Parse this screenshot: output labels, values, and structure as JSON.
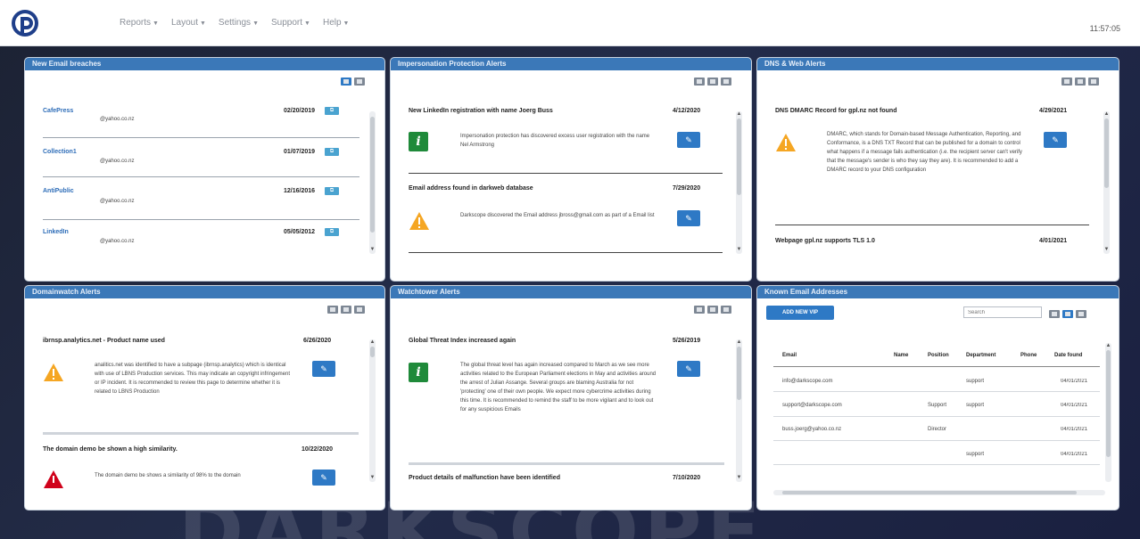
{
  "nav": {
    "items": [
      "Reports",
      "Layout",
      "Settings",
      "Support",
      "Help"
    ],
    "clock": "11:57:05"
  },
  "colors": {
    "header_blue": "#3b78b8",
    "button_blue": "#2e79c5",
    "info_green": "#1f8a3a",
    "warning_orange": "#f5a623",
    "danger_red": "#d0021b"
  },
  "panels": {
    "breaches": {
      "title": "New Email breaches",
      "rows": [
        {
          "source": "CafePress",
          "date": "02/20/2019",
          "email": "@yahoo.co.nz"
        },
        {
          "source": "Collection1",
          "date": "01/07/2019",
          "email": "@yahoo.co.nz"
        },
        {
          "source": "AntiPublic",
          "date": "12/16/2016",
          "email": "@yahoo.co.nz"
        },
        {
          "source": "LinkedIn",
          "date": "05/05/2012",
          "email": "@yahoo.co.nz"
        }
      ]
    },
    "impersonation": {
      "title": "Impersonation Protection Alerts",
      "alerts": [
        {
          "title": "New LinkedIn registration with name Joerg Buss",
          "date": "4/12/2020",
          "text": "Impersonation protection has discovered excess user registration with the name Nel Armstrong"
        },
        {
          "title": "Email address found in darkweb database",
          "date": "7/29/2020",
          "text": "Darkscope discovered the Email address jbross@gmail.com as part of a Email list"
        }
      ]
    },
    "dns": {
      "title": "DNS & Web Alerts",
      "alerts": [
        {
          "title": "DNS DMARC Record for gpl.nz not found",
          "date": "4/29/2021",
          "text": "DMARC, which stands for Domain-based Message Authentication, Reporting, and Conformance, is a DNS TXT Record that can be published for a domain to control what happens if a message fails authentication (i.e. the recipient server can't verify that the message's sender is who they say they are). It is recommended to add a DMARC record to your DNS configuration"
        },
        {
          "title": "Webpage gpl.nz supports TLS 1.0",
          "date": "4/01/2021"
        }
      ]
    },
    "domainwatch": {
      "title": "Domainwatch Alerts",
      "alerts": [
        {
          "title": "ibrnsp.analytics.net - Product name used",
          "date": "6/26/2020",
          "text": "analitics.net was identified to have a subpage (ibrnsp.analytics) which is identical with use of LBNS Production services. This may indicate an copyright infringement or IP incident. It is recommended to review this page to determine whether it is related to LBNS Production"
        },
        {
          "title": "The domain demo be shown a high similarity.",
          "date": "10/22/2020",
          "text": "The domain demo be shows a similarity of 98% to the domain"
        }
      ]
    },
    "watchtower": {
      "title": "Watchtower Alerts",
      "alerts": [
        {
          "title": "Global Threat Index increased again",
          "date": "5/26/2019",
          "text": "The global threat level has again increased compared to March as we see more activities related to the European Parliament elections in May and activities around the arrest of Julian Assange. Several groups are blaming Australia for not 'protecting' one of their own people. We expect more cybercrime activities during this time. It is recommended to remind the staff to be more vigilant and to look out for any suspicious Emails"
        },
        {
          "title": "Product details of malfunction have been identified",
          "date": "7/10/2020"
        }
      ]
    },
    "known_emails": {
      "title": "Known Email Addresses",
      "add_button": "ADD NEW VIP",
      "search_placeholder": "Search",
      "columns": [
        "Email",
        "Name",
        "Position",
        "Department",
        "Phone",
        "Date found"
      ],
      "rows": [
        {
          "email": "info@darkscope.com",
          "name": "",
          "position": "",
          "department": "support",
          "phone": "",
          "date": "04/01/2021"
        },
        {
          "email": "support@darkscope.com",
          "name": "",
          "position": "Support",
          "department": "support",
          "phone": "",
          "date": "04/01/2021"
        },
        {
          "email": "buss.joerg@yahoo.co.nz",
          "name": "",
          "position": "Director",
          "department": "",
          "phone": "",
          "date": "04/01/2021"
        },
        {
          "email": "",
          "name": "",
          "position": "",
          "department": "support",
          "phone": "",
          "date": "04/01/2021"
        }
      ]
    }
  },
  "background_wordmark": "DARKSCOPE"
}
